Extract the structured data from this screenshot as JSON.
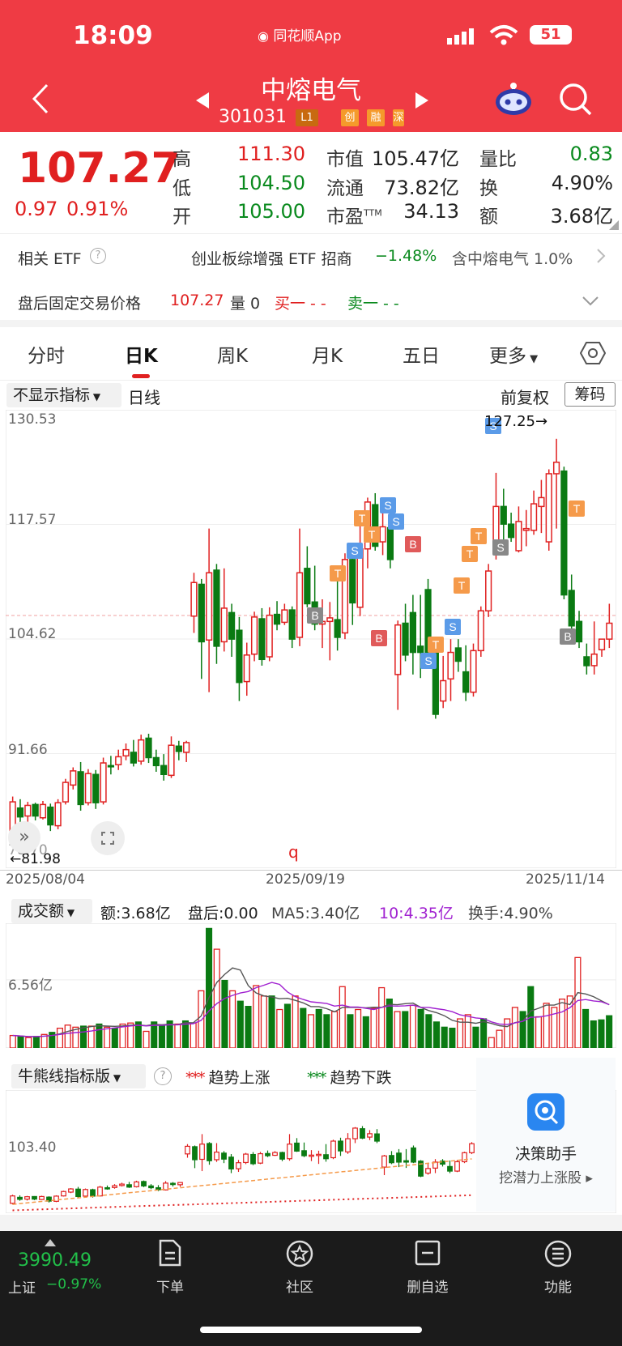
{
  "status": {
    "time": "18:09",
    "app_name": "同花顺App",
    "battery": "51"
  },
  "header": {
    "title": "中熔电气",
    "code": "301031",
    "tags": [
      "L1",
      "创",
      "融",
      "深"
    ]
  },
  "quote": {
    "price": "107.27",
    "change": "0.97",
    "change_pct": "0.91%",
    "high_label": "高",
    "high": "111.30",
    "low_label": "低",
    "low": "104.50",
    "open_label": "开",
    "open": "105.00",
    "mcap_label": "市值",
    "mcap": "105.47亿",
    "float_label": "流通",
    "float": "73.82亿",
    "pe_label": "市盈",
    "pe_sup": "TTM",
    "pe": "34.13",
    "vr_label": "量比",
    "vr": "0.83",
    "turn_label": "换",
    "turn": "4.90%",
    "amt_label": "额",
    "amt": "3.68亿"
  },
  "etf": {
    "label": "相关 ETF",
    "name": "创业板综增强 ETF 招商",
    "change": "−1.48%",
    "hold": "含中熔电气 1.0%"
  },
  "after_hours": {
    "label": "盘后固定交易价格",
    "price": "107.27",
    "vol_label": "量 0",
    "buy": "买一 - -",
    "sell": "卖一 - -"
  },
  "tabs": [
    "分时",
    "日K",
    "周K",
    "月K",
    "五日",
    "更多"
  ],
  "chart_toolbar": {
    "indicator": "不显示指标",
    "period": "日线",
    "adjust": "前复权",
    "chips": "筹码"
  },
  "chart_data": {
    "type": "candlestick",
    "y_ticks": [
      "130.53",
      "117.57",
      "104.62",
      "91.66",
      "78.70"
    ],
    "x_ticks": [
      "2025/08/04",
      "2025/09/19",
      "2025/11/14"
    ],
    "ylim": [
      78.7,
      130.53
    ],
    "high_marker": "127.25→",
    "low_marker": "←81.98",
    "candles": [
      [
        82.5,
        86.8,
        81.98,
        86.2
      ],
      [
        85.5,
        86.5,
        83.8,
        84.5
      ],
      [
        84.6,
        86.2,
        83.9,
        85.8
      ],
      [
        85.9,
        86.1,
        84.1,
        84.6
      ],
      [
        84.4,
        86.3,
        84.2,
        85.9
      ],
      [
        85.6,
        86.0,
        82.9,
        83.6
      ],
      [
        83.5,
        86.5,
        83.1,
        86.1
      ],
      [
        86.2,
        88.8,
        85.9,
        88.4
      ],
      [
        88.1,
        90.1,
        87.6,
        89.7
      ],
      [
        89.6,
        90.7,
        85.2,
        85.9
      ],
      [
        86.1,
        89.9,
        85.8,
        89.4
      ],
      [
        89.3,
        89.8,
        85.4,
        86.1
      ],
      [
        86.2,
        91.2,
        85.9,
        90.6
      ],
      [
        90.3,
        91.4,
        89.3,
        90.2
      ],
      [
        90.4,
        92.1,
        89.8,
        91.3
      ],
      [
        91.4,
        92.8,
        90.9,
        92.1
      ],
      [
        91.8,
        93.2,
        90.2,
        90.6
      ],
      [
        90.8,
        93.8,
        90.4,
        93.2
      ],
      [
        93.4,
        93.9,
        90.6,
        91.2
      ],
      [
        91.2,
        92.1,
        89.6,
        90.3
      ],
      [
        90.3,
        91.6,
        88.6,
        89.3
      ],
      [
        89.2,
        93.6,
        88.9,
        92.6
      ],
      [
        92.5,
        93.1,
        90.9,
        91.9
      ],
      [
        91.8,
        93.1,
        90.7,
        92.9
      ],
      [
        107.2,
        112.1,
        105.3,
        111.0
      ],
      [
        110.8,
        111.4,
        100.1,
        104.3
      ],
      [
        104.5,
        117.1,
        98.6,
        112.1
      ],
      [
        112.4,
        113.1,
        101.8,
        103.8
      ],
      [
        104.3,
        112.6,
        103.2,
        108.1
      ],
      [
        107.6,
        108.6,
        102.6,
        104.6
      ],
      [
        105.6,
        107.1,
        97.6,
        99.7
      ],
      [
        99.8,
        104.2,
        98.2,
        102.8
      ],
      [
        102.9,
        107.7,
        102.1,
        107.1
      ],
      [
        106.9,
        108.1,
        101.6,
        102.3
      ],
      [
        102.6,
        108.2,
        102.1,
        107.3
      ],
      [
        107.4,
        108.9,
        105.6,
        106.3
      ],
      [
        106.5,
        108.6,
        106.2,
        107.9
      ],
      [
        107.9,
        108.3,
        103.6,
        104.6
      ],
      [
        104.8,
        117.1,
        103.8,
        112.1
      ],
      [
        112.6,
        115.1,
        108.2,
        108.6
      ],
      [
        108.8,
        112.9,
        105.6,
        106.3
      ],
      [
        106.3,
        109.1,
        103.6,
        106.6
      ],
      [
        106.6,
        108.8,
        102.2,
        107.0
      ],
      [
        106.8,
        112.1,
        103.3,
        104.8
      ],
      [
        105.3,
        114.3,
        104.6,
        113.6
      ],
      [
        113.6,
        115.3,
        106.2,
        108.7
      ],
      [
        108.2,
        117.6,
        107.2,
        114.8
      ],
      [
        114.8,
        120.6,
        112.6,
        120.1
      ],
      [
        119.8,
        121.1,
        114.6,
        115.1
      ],
      [
        115.6,
        119.1,
        114.1,
        117.3
      ],
      [
        117.2,
        119.6,
        112.6,
        113.6
      ],
      [
        100.6,
        106.7,
        96.6,
        106.2
      ],
      [
        106.4,
        108.6,
        102.1,
        102.8
      ],
      [
        107.6,
        109.6,
        100.6,
        103.1
      ],
      [
        103.8,
        109.6,
        100.2,
        103.1
      ],
      [
        110.2,
        111.4,
        102.6,
        103.1
      ],
      [
        103.6,
        104.1,
        95.6,
        96.1
      ],
      [
        97.6,
        102.7,
        96.8,
        99.9
      ],
      [
        100.1,
        104.6,
        97.6,
        103.1
      ],
      [
        103.6,
        104.6,
        100.9,
        102.1
      ],
      [
        100.9,
        103.9,
        97.6,
        98.6
      ],
      [
        98.6,
        104.1,
        98.1,
        103.3
      ],
      [
        103.3,
        108.3,
        102.6,
        107.8
      ],
      [
        107.8,
        113.1,
        107.1,
        112.3
      ],
      [
        115.2,
        123.4,
        113.6,
        119.6
      ],
      [
        119.6,
        121.6,
        115.1,
        117.6
      ],
      [
        117.6,
        118.9,
        115.6,
        116.1
      ],
      [
        114.6,
        119.6,
        114.4,
        117.9
      ],
      [
        116.9,
        119.2,
        115.1,
        117.1
      ],
      [
        116.9,
        121.4,
        116.4,
        119.9
      ],
      [
        119.6,
        122.6,
        116.6,
        120.6
      ],
      [
        115.6,
        123.8,
        114.6,
        123.3
      ],
      [
        123.3,
        127.25,
        117.1,
        124.6
      ],
      [
        123.6,
        124.1,
        109.1,
        109.6
      ],
      [
        110.1,
        111.9,
        104.6,
        106.1
      ],
      [
        106.6,
        107.8,
        103.6,
        104.3
      ],
      [
        102.6,
        104.1,
        100.6,
        101.6
      ],
      [
        101.6,
        106.6,
        100.6,
        102.9
      ],
      [
        103.4,
        104.6,
        102.6,
        104.6
      ],
      [
        104.6,
        108.6,
        103.6,
        106.4
      ]
    ],
    "signals": [
      {
        "label": "B",
        "color": "#888888"
      },
      {
        "label": "T",
        "color": "#f59a4a"
      },
      {
        "label": "S",
        "color": "#5b9be8"
      },
      {
        "label": "T",
        "color": "#f59a4a"
      },
      {
        "label": "T",
        "color": "#f59a4a"
      },
      {
        "label": "S",
        "color": "#5b9be8"
      },
      {
        "label": "S",
        "color": "#5b9be8"
      },
      {
        "label": "B",
        "color": "#e05a5a"
      },
      {
        "label": "B",
        "color": "#e05a5a"
      },
      {
        "label": "S",
        "color": "#5b9be8"
      },
      {
        "label": "T",
        "color": "#f59a4a"
      },
      {
        "label": "S",
        "color": "#5b9be8"
      },
      {
        "label": "T",
        "color": "#f59a4a"
      },
      {
        "label": "T",
        "color": "#f59a4a"
      },
      {
        "label": "T",
        "color": "#f59a4a"
      },
      {
        "label": "S",
        "color": "#5b9be8"
      },
      {
        "label": "S",
        "color": "#888888"
      },
      {
        "label": "T",
        "color": "#f59a4a"
      },
      {
        "label": "B",
        "color": "#888888"
      }
    ]
  },
  "volume": {
    "selector": "成交额",
    "amt": "额:3.68亿",
    "after": "盘后:0.00",
    "ma5": "MA5:3.40亿",
    "ma10": "10:4.35亿",
    "turn": "换手:4.90%",
    "y_tick": "6.56亿",
    "values": [
      1.2,
      1.1,
      1.0,
      1.1,
      1.3,
      1.5,
      1.9,
      2.2,
      2.0,
      2.1,
      2.1,
      2.3,
      2.0,
      1.9,
      2.3,
      2.4,
      2.5,
      1.6,
      2.5,
      2.2,
      2.6,
      2.3,
      2.6,
      2.4,
      5.5,
      11.5,
      9.5,
      6.5,
      5.5,
      4.5,
      4.0,
      6.0,
      5.0,
      5.0,
      3.7,
      4.2,
      5.0,
      3.8,
      3.2,
      3.7,
      3.2,
      3.5,
      5.9,
      3.2,
      3.7,
      3.0,
      3.8,
      5.8,
      4.7,
      3.5,
      3.5,
      4.1,
      3.7,
      3.2,
      2.5,
      2.0,
      1.9,
      2.8,
      3.2,
      2.0,
      2.8,
      1.0,
      1.7,
      2.8,
      3.9,
      3.5,
      5.9,
      3.0,
      4.3,
      3.9,
      4.7,
      5.0,
      8.7,
      3.7,
      2.6,
      2.7,
      3.1
    ]
  },
  "bull_bear": {
    "selector": "牛熊线指标版",
    "up": "趋势上涨",
    "down": "趋势下跌",
    "y_tick": "103.40"
  },
  "assistant": {
    "title": "决策助手",
    "subtitle": "挖潜力上涨股"
  },
  "bottom_nav": {
    "index_value": "3990.49",
    "index_name": "上证",
    "index_change": "−0.97%",
    "items": [
      "下单",
      "社区",
      "删自选",
      "功能"
    ]
  }
}
